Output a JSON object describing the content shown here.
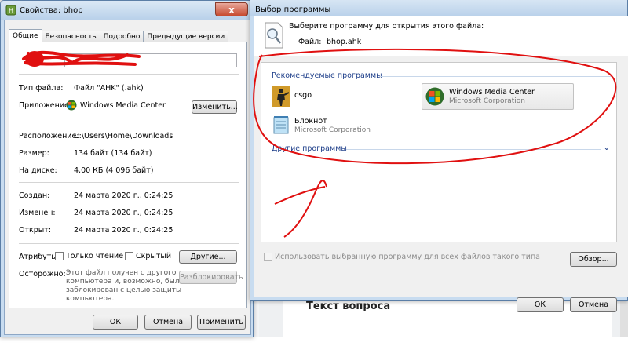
{
  "background": {
    "question_heading": "Текст вопроса"
  },
  "properties": {
    "title": "Свойства: bhop",
    "tabs": [
      "Общие",
      "Безопасность",
      "Подробно",
      "Предыдущие версии"
    ],
    "file_type_label": "Тип файла:",
    "file_type_value": "Файл \"AHK\" (.ahk)",
    "app_label": "Приложение:",
    "app_value": "Windows Media Center",
    "change_button": "Изменить...",
    "location_label": "Расположение:",
    "location_value": "C:\\Users\\Home\\Downloads",
    "size_label": "Размер:",
    "size_value": "134 байт (134 байт)",
    "disk_label": "На диске:",
    "disk_value": "4,00 КБ (4 096 байт)",
    "created_label": "Создан:",
    "created_value": "24 марта 2020 г., 0:24:25",
    "modified_label": "Изменен:",
    "modified_value": "24 марта 2020 г., 0:24:25",
    "opened_label": "Открыт:",
    "opened_value": "24 марта 2020 г., 0:24:25",
    "attributes_label": "Атрибуты:",
    "readonly_label": "Только чтение",
    "hidden_label": "Скрытый",
    "other_button": "Другие...",
    "caution_label": "Осторожно:",
    "caution_text_1": "Этот файл получен с другого",
    "caution_text_2": "компьютера и, возможно, был",
    "caution_text_3": "заблокирован с целью защиты",
    "caution_text_4": "компьютера.",
    "unblock_button": "Разблокировать",
    "ok_button": "ОК",
    "cancel_button": "Отмена",
    "apply_button": "Применить",
    "close_glyph": "x"
  },
  "open_with": {
    "title": "Выбор программы",
    "instruction": "Выберите программу для открытия этого файла:",
    "file_label": "Файл:",
    "file_value": "bhop.ahk",
    "recommended_header": "Рекомендуемые программы",
    "programs": [
      {
        "name": "csgo",
        "publisher": ""
      },
      {
        "name": "Windows Media Center",
        "publisher": "Microsoft Corporation"
      },
      {
        "name": "Блокнот",
        "publisher": "Microsoft Corporation"
      }
    ],
    "other_header": "Другие программы",
    "always_use_label": "Использовать выбранную программу для всех файлов такого типа",
    "browse_button": "Обзор...",
    "ok_button": "ОК",
    "cancel_button": "Отмена",
    "close_glyph": "x"
  },
  "colors": {
    "annotation": "#e01010",
    "group_header": "#1e3f8a",
    "close_button": "#c74a2f"
  }
}
